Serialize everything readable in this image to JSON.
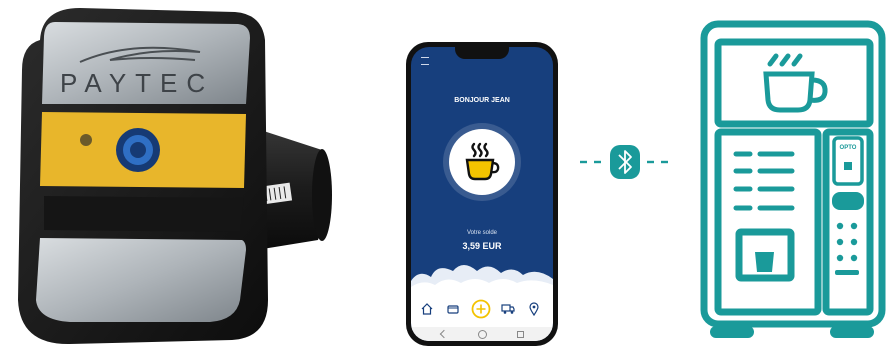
{
  "device": {
    "brand": "PAYTEC"
  },
  "phone": {
    "greeting": "BONJOUR JEAN",
    "balance_label": "Votre solde",
    "balance_value": "3,59 EUR",
    "nav_icons": [
      "home-icon",
      "wallet-icon",
      "add-coin-icon",
      "truck-icon",
      "location-pin-icon"
    ]
  },
  "connector": {
    "icon": "bluetooth-icon"
  },
  "vending_machine": {
    "panel_label": "OPTO",
    "icon": "coffee-cup-icon"
  },
  "colors": {
    "teal": "#1a9a9a",
    "phone_blue": "#173f7d",
    "cup_yellow": "#f3c300",
    "device_yellow": "#e8b62b"
  }
}
